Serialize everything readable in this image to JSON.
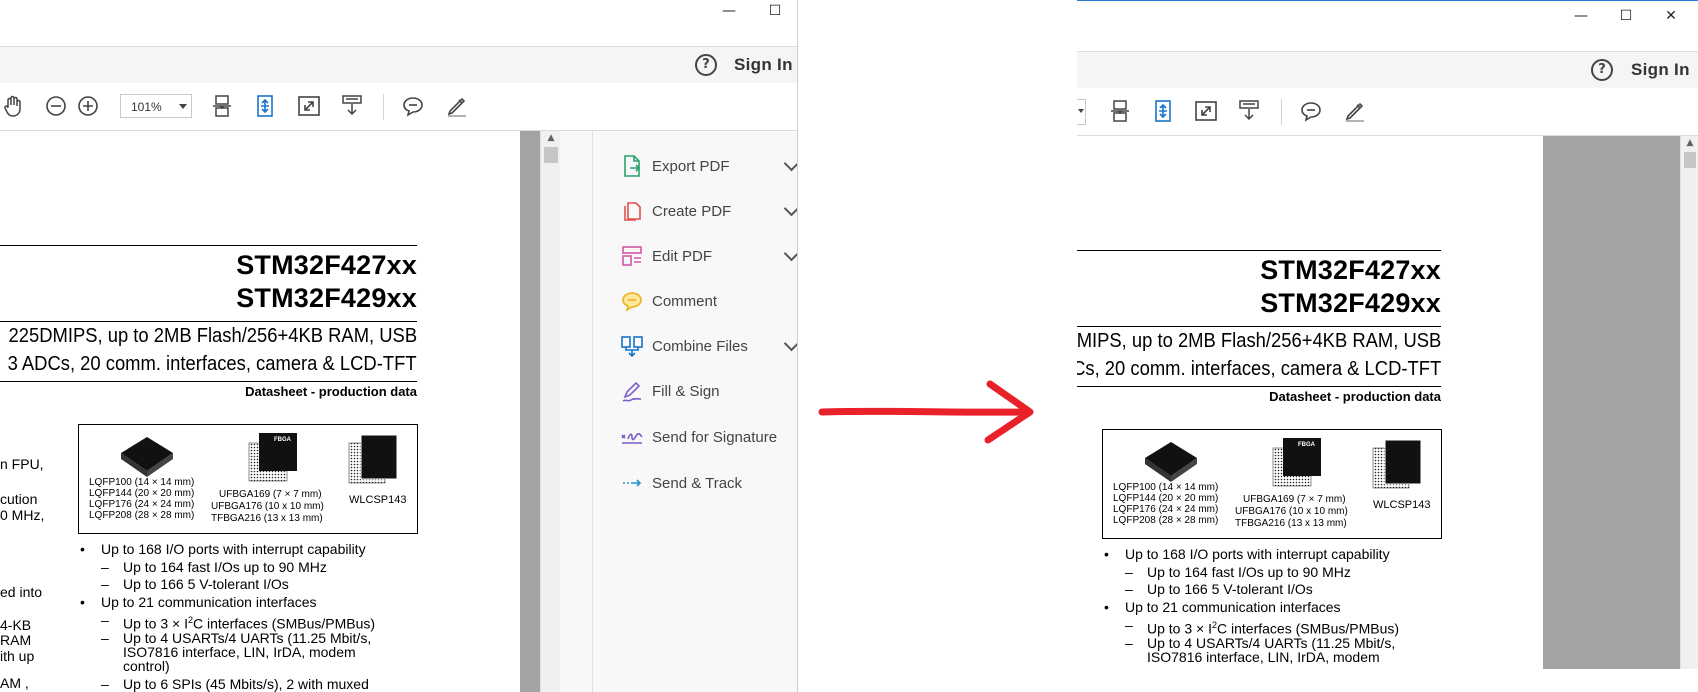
{
  "window": {
    "minimize": "—",
    "maximize": "☐",
    "close": "✕"
  },
  "menubar": {
    "help": "?",
    "sign_in": "Sign In"
  },
  "toolbar": {
    "zoom": "101%"
  },
  "document": {
    "title1": "STM32F427xx",
    "title2": "STM32F429xx",
    "left": {
      "subtitle1": "225DMIPS, up to 2MB Flash/256+4KB RAM, USB",
      "subtitle2": "3 ADCs, 20 comm. interfaces, camera & LCD-TFT",
      "clipped": [
        "n FPU,",
        "cution",
        "0 MHz,",
        "ed into",
        "4-KB",
        "RAM",
        "ith up",
        "AM ,"
      ]
    },
    "right": {
      "subtitle1": "MIPS, up to 2MB Flash/256+4KB RAM, USB",
      "subtitle2": "Cs, 20 comm. interfaces, camera & LCD-TFT"
    },
    "datasheet": "Datasheet - production data",
    "packages": {
      "lqfp": [
        "LQFP100 (14 × 14 mm)",
        "LQFP144 (20 × 20 mm)",
        "LQFP176 (24 × 24 mm)",
        "LQFP208 (28 × 28 mm)"
      ],
      "ufbga": [
        "UFBGA169 (7 × 7 mm)",
        "UFBGA176 (10 x 10 mm)",
        "TFBGA216 (13 x 13 mm)"
      ],
      "wlcsp": "WLCSP143",
      "fbga_chip": "FBGA"
    },
    "bullets": {
      "b1": "Up to 168 I/O ports with interrupt capability",
      "b1a": "Up to 164 fast I/Os up to 90 MHz",
      "b1b": "Up to 166 5 V-tolerant I/Os",
      "b2": "Up to 21 communication interfaces",
      "b2a_pre": "Up to 3 × I",
      "b2a_sup": "2",
      "b2a_post": "C interfaces (SMBus/PMBus)",
      "b2b_1": "Up to 4 USARTs/4 UARTs (11.25 Mbit/s,",
      "b2b_2": "ISO7816 interface, LIN, IrDA, modem",
      "b2b_3": "control)",
      "b2c": "Up to 6 SPIs (45 Mbits/s), 2 with muxed"
    }
  },
  "tools_pane": {
    "items": [
      {
        "label": "Export PDF",
        "icon": "export-pdf-icon"
      },
      {
        "label": "Create PDF",
        "icon": "create-pdf-icon"
      },
      {
        "label": "Edit PDF",
        "icon": "edit-pdf-icon"
      },
      {
        "label": "Comment",
        "icon": "comment-icon"
      },
      {
        "label": "Combine Files",
        "icon": "combine-files-icon"
      },
      {
        "label": "Fill & Sign",
        "icon": "fill-sign-icon"
      },
      {
        "label": "Send for Signature",
        "icon": "send-for-signature-icon"
      },
      {
        "label": "Send & Track",
        "icon": "send-track-icon"
      }
    ]
  },
  "colors": {
    "arrow": "#e8212a",
    "accent": "#2b7bd6",
    "tool_icon_blue": "#1a73c8"
  }
}
